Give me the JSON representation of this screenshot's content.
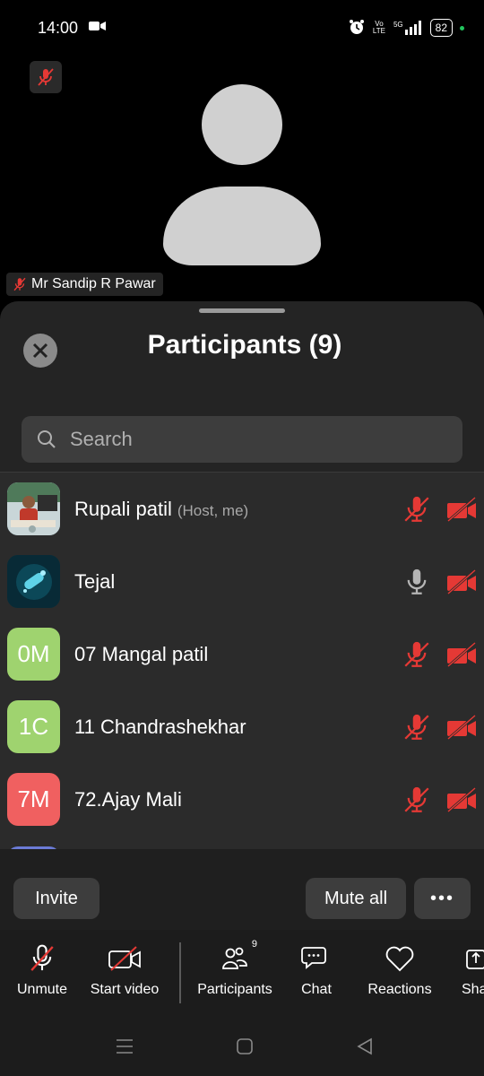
{
  "status": {
    "time": "14:00",
    "network": "5G",
    "volte": "Vo LTE",
    "battery": "82"
  },
  "video": {
    "speaker_name": "Mr Sandip R Pawar"
  },
  "panel": {
    "title": "Participants (9)",
    "search_placeholder": "Search",
    "participants": [
      {
        "name": "Rupali patil",
        "sub": "(Host, me)",
        "initials": "",
        "avatar_color": "#7fa3b3",
        "mic": "muted",
        "cam": "off"
      },
      {
        "name": "Tejal",
        "sub": "",
        "initials": "",
        "avatar_color": "#0b3a4a",
        "mic": "on",
        "cam": "off"
      },
      {
        "name": "07 Mangal patil",
        "sub": "",
        "initials": "0M",
        "avatar_color": "#9fd36f",
        "mic": "muted",
        "cam": "off"
      },
      {
        "name": "11 Chandrashekhar",
        "sub": "",
        "initials": "1C",
        "avatar_color": "#9fd36f",
        "mic": "muted",
        "cam": "off"
      },
      {
        "name": "72.Ajay Mali",
        "sub": "",
        "initials": "7M",
        "avatar_color": "#f06060",
        "mic": "muted",
        "cam": "off"
      },
      {
        "name": "",
        "sub": "",
        "initials": "",
        "avatar_color": "#6b7bd6",
        "mic": "",
        "cam": ""
      }
    ],
    "invite_label": "Invite",
    "mute_all_label": "Mute all",
    "more_label": "•••"
  },
  "toolbar": {
    "unmute_label": "Unmute",
    "start_video_label": "Start video",
    "participants_label": "Participants",
    "participants_count": "9",
    "chat_label": "Chat",
    "reactions_label": "Reactions",
    "share_label": "Sha"
  },
  "colors": {
    "muted_red": "#e53935",
    "panel_bg": "#242424",
    "row_bg": "#2b2b2b"
  }
}
